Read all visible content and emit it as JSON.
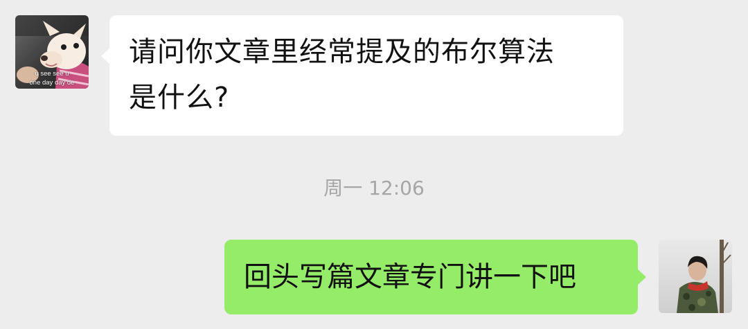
{
  "conversation": {
    "incoming": {
      "avatar_icon": "chihuahua-photo-avatar",
      "avatar_caption_1": "u see see u",
      "avatar_caption_2": "one day day de",
      "line1": "请问你文章里经常提及的布尔算法",
      "line2": "是什么?"
    },
    "timestamp": "周一 12:06",
    "outgoing": {
      "avatar_icon": "person-photo-avatar",
      "text": "回头写篇文章专门讲一下吧"
    }
  },
  "colors": {
    "background": "#ededed",
    "incoming_bubble": "#ffffff",
    "outgoing_bubble": "#95ec69",
    "timestamp": "#a6a6a6",
    "message_text": "#111111"
  }
}
